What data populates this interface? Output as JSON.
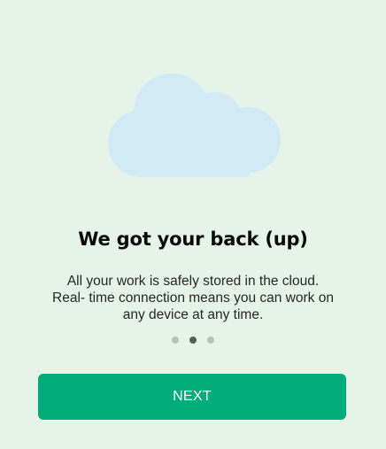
{
  "onboarding": {
    "illustration_icon": "cloud-icon",
    "title": "We got your back (up)",
    "description_lines": [
      "All your work is safely stored in the cloud.",
      "Real- time connection means you can work on",
      "any device at any time."
    ],
    "pagination": {
      "total_pages": 3,
      "active_page": 2
    },
    "next_label": "NEXT"
  },
  "colors": {
    "background": "#e6f3e9",
    "cloud": "#d1eaf6",
    "accent": "#00ad7a",
    "dot_inactive": "#b9c1bb",
    "dot_active": "#555d57"
  }
}
